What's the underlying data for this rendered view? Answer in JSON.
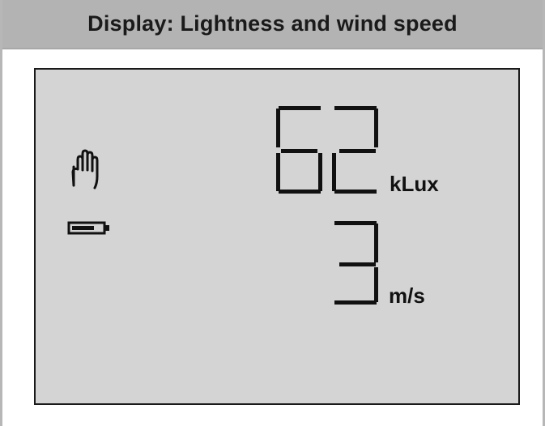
{
  "header": {
    "title": "Display: Lightness and wind speed"
  },
  "display": {
    "lightness": {
      "value": "62",
      "unit": "kLux"
    },
    "wind_speed": {
      "value": "3",
      "unit": "m/s"
    },
    "icons": [
      "hand-icon",
      "battery-icon"
    ]
  },
  "colors": {
    "header_bg": "#b3b3b3",
    "lcd_bg": "#d4d4d4",
    "segment": "#111111"
  }
}
